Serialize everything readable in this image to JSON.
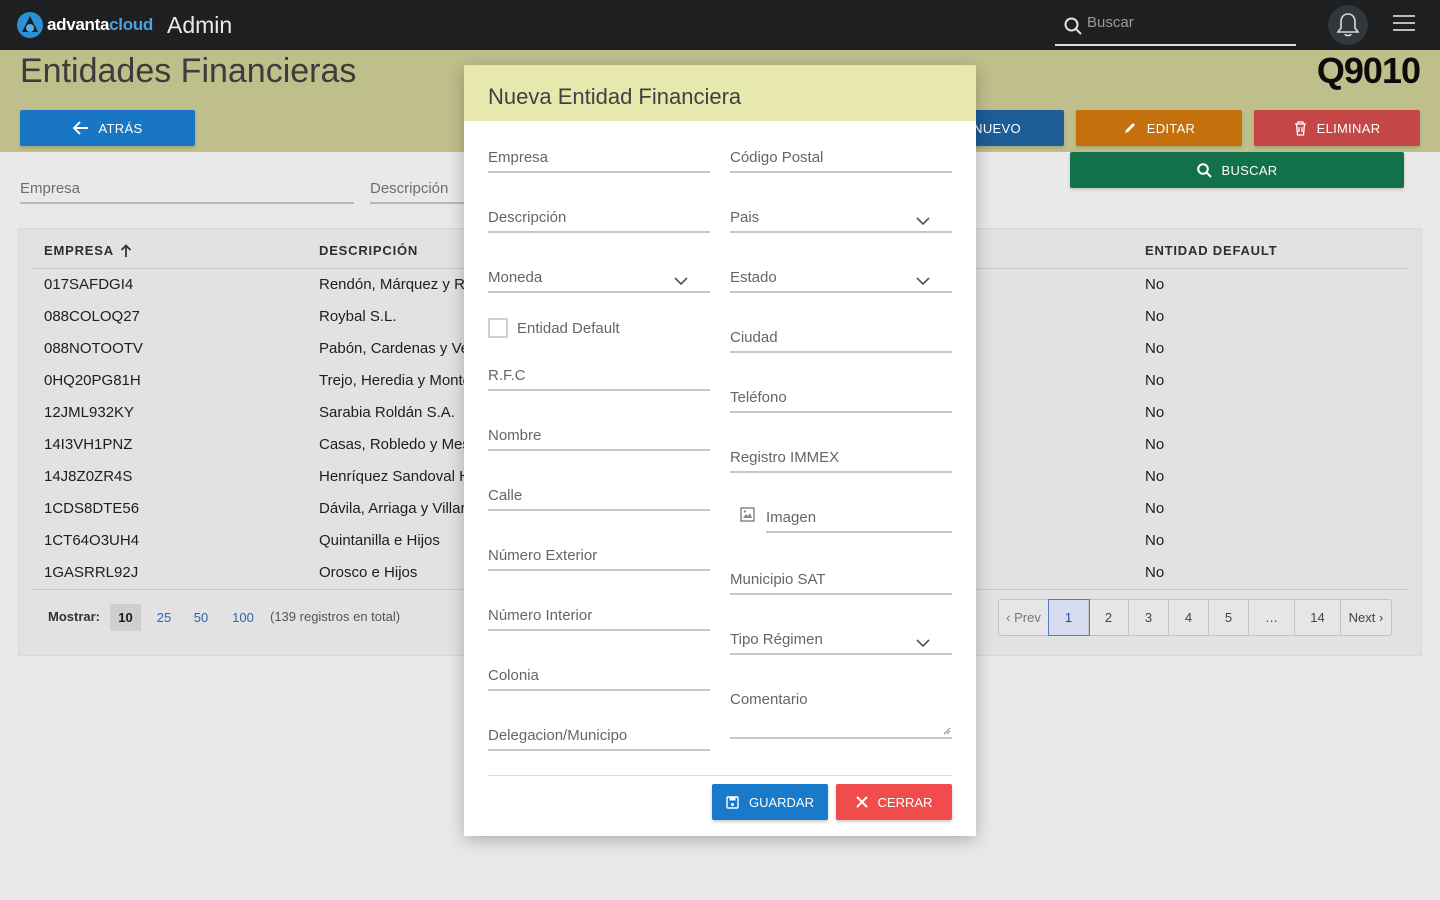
{
  "app": {
    "logo_part1": "advanta",
    "logo_part2": "cloud",
    "section": "Admin",
    "search_placeholder": "Buscar"
  },
  "page": {
    "title": "Entidades Financieras",
    "code": "Q9010"
  },
  "actions": {
    "back": "ATRÁS",
    "new": "NUEVO",
    "edit": "EDITAR",
    "delete": "ELIMINAR",
    "search": "BUSCAR"
  },
  "filters": {
    "empresa": "Empresa",
    "descripcion": "Descripción"
  },
  "table": {
    "headers": {
      "empresa": "EMPRESA",
      "descripcion": "DESCRIPCIÓN",
      "entidad_default": "ENTIDAD DEFAULT"
    },
    "rows": [
      {
        "empresa": "017SAFDGI4",
        "descripcion": "Rendón, Márquez y Ra",
        "default": "No"
      },
      {
        "empresa": "088COLOQ27",
        "descripcion": "Roybal S.L.",
        "default": "No"
      },
      {
        "empresa": "088NOTOOTV",
        "descripcion": "Pabón, Cardenas y Vel",
        "default": "No"
      },
      {
        "empresa": "0HQ20PG81H",
        "descripcion": "Trejo, Heredia y Monte",
        "default": "No"
      },
      {
        "empresa": "12JML932KY",
        "descripcion": "Sarabia Roldán S.A.",
        "default": "No"
      },
      {
        "empresa": "14I3VH1PNZ",
        "descripcion": "Casas, Robledo y Mesa",
        "default": "No"
      },
      {
        "empresa": "14J8Z0ZR4S",
        "descripcion": "Henríquez Sandoval H",
        "default": "No"
      },
      {
        "empresa": "1CDS8DTE56",
        "descripcion": "Dávila, Arriaga y Villar",
        "default": "No"
      },
      {
        "empresa": "1CT64O3UH4",
        "descripcion": "Quintanilla e Hijos",
        "default": "No"
      },
      {
        "empresa": "1GASRRL92J",
        "descripcion": "Orosco e Hijos",
        "default": "No"
      }
    ]
  },
  "footer": {
    "show_label": "Mostrar:",
    "page_sizes": [
      "10",
      "25",
      "50",
      "100"
    ],
    "selected_page_size": "10",
    "total_text": "(139 registros en total)",
    "pages": [
      "‹ Prev",
      "1",
      "2",
      "3",
      "4",
      "5",
      "…",
      "14",
      "Next ›"
    ],
    "current_page": "1"
  },
  "modal": {
    "title": "Nueva Entidad Financiera",
    "fields": {
      "empresa": "Empresa",
      "codigo_postal": "Código Postal",
      "descripcion": "Descripción",
      "pais": "Pais",
      "moneda": "Moneda",
      "estado": "Estado",
      "entidad_default": "Entidad Default",
      "ciudad": "Ciudad",
      "rfc": "R.F.C",
      "telefono": "Teléfono",
      "nombre": "Nombre",
      "registro_immex": "Registro IMMEX",
      "calle": "Calle",
      "imagen": "Imagen",
      "numero_exterior": "Número Exterior",
      "municipio_sat": "Municipio SAT",
      "numero_interior": "Número Interior",
      "tipo_regimen": "Tipo Régimen",
      "colonia": "Colonia",
      "comentario": "Comentario",
      "delegacion": "Delegacion/Municipo"
    },
    "save": "GUARDAR",
    "close": "CERRAR"
  }
}
